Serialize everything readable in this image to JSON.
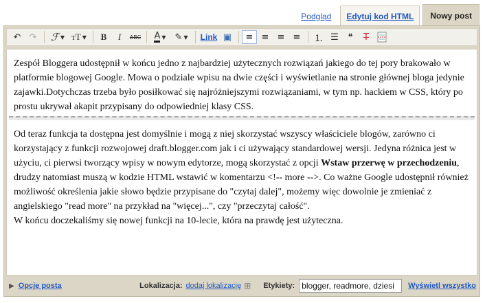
{
  "tabs": {
    "preview": "Podgląd",
    "edit_html": "Edytuj kod HTML",
    "compose": "Nowy post"
  },
  "toolbar": {
    "undo": "↶",
    "redo": "↷",
    "font": "ℱ",
    "font_size": "тT",
    "bold": "B",
    "italic": "I",
    "strikethrough": "ABC",
    "text_color": "A",
    "highlight": "✎",
    "link": "Link",
    "image": "▣",
    "align_left": "≡",
    "align_center": "≡",
    "align_right": "≡",
    "justify": "≡",
    "numbered_list": "⒈",
    "bullet_list": "☰",
    "quote": "❝",
    "remove_format": "T̶",
    "caret": "▼"
  },
  "post": {
    "paragraph1": "Zespół Bloggera udostępnił w końcu jedno z najbardziej użytecznych rozwiązań jakiego do tej pory brakowało w platformie blogowej Google. Mowa o podziale wpisu na dwie części i wyświetlanie na stronie głównej bloga jedynie zajawki.Dotychczas trzeba było posiłkować się najróżniejszymi rozwiązaniami, w tym np. hackiem w CSS, który po prostu ukrywał akapit przypisany do odpowiedniej klasy CSS.",
    "paragraph2_start": "Od teraz funkcja ta dostępna jest domyślnie i mogą z niej skorzystać wszyscy właściciele blogów, zarówno ci korzystający z funkcji rozwojowej draft.blogger.com jak i ci używający standardowej wersji. Jedyna różnica jest w użyciu, ci pierwsi tworzący wpisy w nowym edytorze, mogą skorzystać z opcji ",
    "paragraph2_bold": "Wstaw przerwę w przechodzeniu",
    "paragraph2_end": ", drudzy natomiast muszą w kodzie HTML wstawić w komentarzu <!-- more -->. Co ważne Google udostępnił również możliwość określenia jakie słowo będzie przypisane do \"czytaj dalej\", możemy więc dowolnie je zmieniać z angielskiego \"read more\" na przykład na \"więcej...\", czy \"przeczytaj całość\".",
    "paragraph3": "W końcu doczekaliśmy się nowej funkcji na 10-lecie, która na prawdę jest użyteczna."
  },
  "bottom": {
    "arrow": "▶",
    "post_options": "Opcje posta",
    "location_label": "Lokalizacja:",
    "add_location": "dodaj lokalizację",
    "map_icon": "⊞",
    "labels_label": "Etykiety:",
    "labels_value": "blogger, readmore, dziesi",
    "show_all": "Wyświetl wszystko"
  }
}
